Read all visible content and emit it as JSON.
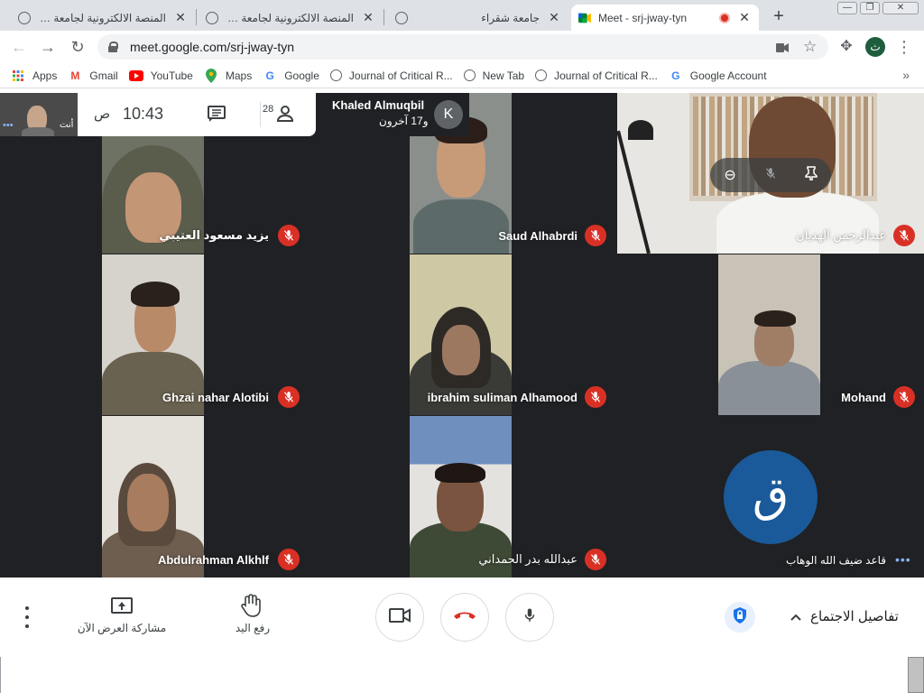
{
  "browser": {
    "tabs": [
      {
        "title": "المنصة الالكترونية لجامعة شقراء -",
        "active": false
      },
      {
        "title": "المنصة الالكترونية لجامعة شقراء -",
        "active": false
      },
      {
        "title": "جامعة شقراء",
        "active": false
      },
      {
        "title": "Meet - srj-jway-tyn",
        "active": true
      }
    ],
    "url": "meet.google.com/srj-jway-tyn",
    "profile_initial": "ث",
    "bookmarks": [
      {
        "label": "Apps",
        "icon": "apps-grid-icon"
      },
      {
        "label": "Gmail",
        "icon": "gmail-icon"
      },
      {
        "label": "YouTube",
        "icon": "youtube-icon"
      },
      {
        "label": "Maps",
        "icon": "maps-pin-icon"
      },
      {
        "label": "Google",
        "icon": "google-icon"
      },
      {
        "label": "Journal of Critical R...",
        "icon": "globe-icon"
      },
      {
        "label": "New Tab",
        "icon": "globe-icon"
      },
      {
        "label": "Journal of Critical R...",
        "icon": "globe-icon"
      },
      {
        "label": "Google Account",
        "icon": "google-icon"
      }
    ],
    "bookmarks_more": "»"
  },
  "meet": {
    "time": "10:43",
    "ampm": "ص",
    "participant_count": "28",
    "self_label": "أنت",
    "presenter": {
      "name": "Khaled Almuqbil",
      "others": "و17 آخرون",
      "initial": "K"
    },
    "tiles": [
      {
        "name": "يزيد مسعود العتيبي",
        "muted": true
      },
      {
        "name": "Saud Alhabrdi",
        "muted": true
      },
      {
        "name": "عبدالرحمن الهديان",
        "muted": true
      },
      {
        "name": "Ghzai nahar Alotibi",
        "muted": true
      },
      {
        "name": "ibrahim suliman Alhamood",
        "muted": true
      },
      {
        "name": "Mohand",
        "muted": true
      },
      {
        "name": "Abdulrahman Alkhlf",
        "muted": true
      },
      {
        "name": "عبدالله بدر الحمداني",
        "muted": true
      },
      {
        "name": "قاعد ضيف الله الوهاب",
        "muted": false,
        "avatar_initial": "ق",
        "avatar_color": "#1a5a9a"
      }
    ]
  },
  "controls": {
    "more_options": "more-vert-icon",
    "present_label": "مشاركة العرض الآن",
    "raise_hand_label": "رفع اليد",
    "meeting_details_label": "تفاصيل الاجتماع",
    "colors": {
      "end_call": "#d93025",
      "mute_badge": "#d93025",
      "accent": "#1a73e8"
    }
  }
}
